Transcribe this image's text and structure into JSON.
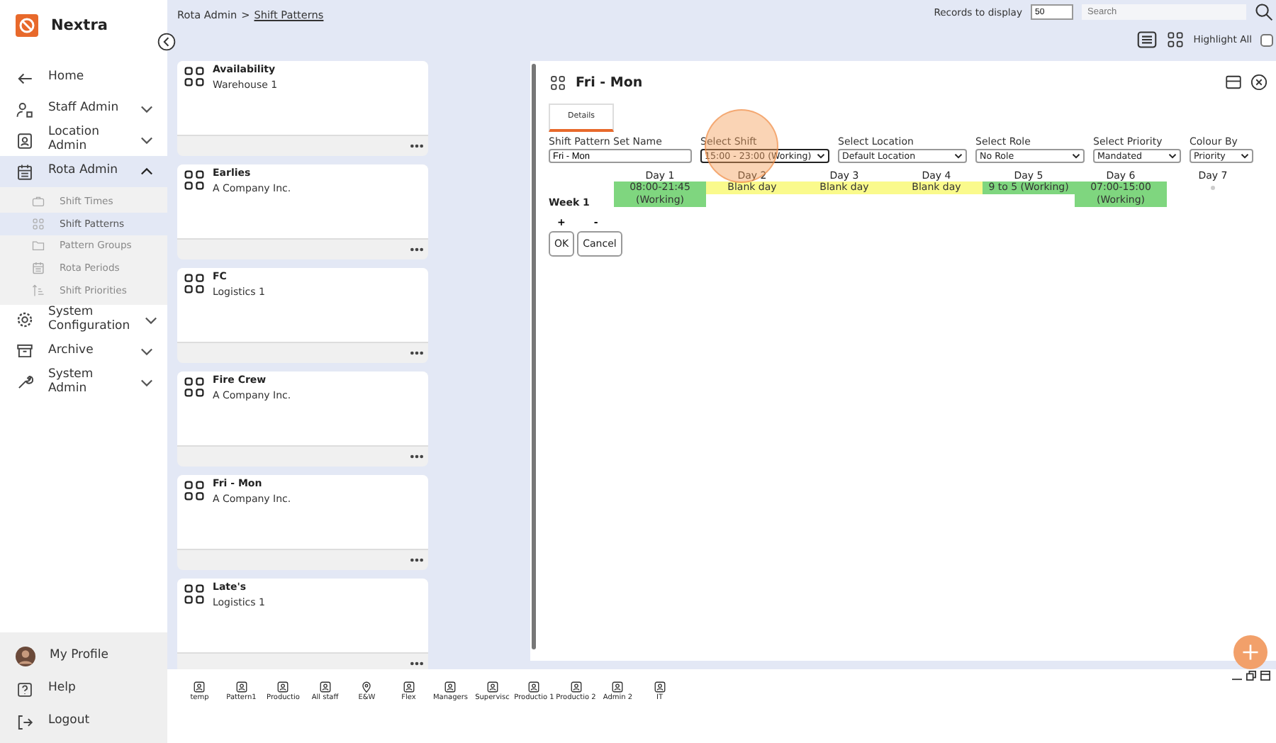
{
  "brand": {
    "name": "Nextra"
  },
  "nav": [
    {
      "label": "Home",
      "selected": false
    },
    {
      "label": "Staff Admin",
      "expanded": false,
      "selected": false
    },
    {
      "label": "Location Admin",
      "expanded": false,
      "selected": false
    },
    {
      "label": "Rota Admin",
      "expanded": true,
      "selected": true,
      "children": [
        {
          "label": "Shift Times",
          "selected": false
        },
        {
          "label": "Shift Patterns",
          "selected": true
        },
        {
          "label": "Pattern Groups",
          "selected": false
        },
        {
          "label": "Rota Periods",
          "selected": false
        },
        {
          "label": "Shift Priorities",
          "selected": false
        }
      ]
    },
    {
      "label": "System Configuration",
      "expanded": false,
      "selected": false
    },
    {
      "label": "Archive",
      "expanded": false,
      "selected": false
    },
    {
      "label": "System Admin",
      "expanded": false,
      "selected": false
    }
  ],
  "footer": [
    {
      "label": "My Profile"
    },
    {
      "label": "Help"
    },
    {
      "label": "Logout"
    }
  ],
  "breadcrumb": {
    "parent": "Rota Admin",
    "separator": ">",
    "current": "Shift Patterns"
  },
  "toolbar": {
    "records_label": "Records to display",
    "records_value": "50",
    "search_placeholder": "Search",
    "highlight_label": "Highlight All",
    "highlight_checked": false
  },
  "cards": [
    {
      "title": "Availability",
      "subtitle": "Warehouse 1"
    },
    {
      "title": "Earlies",
      "subtitle": "A Company Inc."
    },
    {
      "title": "FC",
      "subtitle": "Logistics 1"
    },
    {
      "title": "Fire Crew",
      "subtitle": "A Company Inc."
    },
    {
      "title": "Fri - Mon",
      "subtitle": "A Company Inc."
    },
    {
      "title": "Late's",
      "subtitle": "Logistics 1"
    }
  ],
  "detail": {
    "title": "Fri - Mon",
    "tabs": [
      {
        "label": "Details",
        "selected": true
      }
    ],
    "fields": [
      {
        "label": "Shift Pattern Set Name",
        "kind": "text",
        "value": "Fri - Mon"
      },
      {
        "label": "Select Shift",
        "kind": "select",
        "value": "15:00 - 23:00 (Working)"
      },
      {
        "label": "Select Location",
        "kind": "select",
        "value": "Default Location"
      },
      {
        "label": "Select Role",
        "kind": "select",
        "value": "No Role"
      },
      {
        "label": "Select Priority",
        "kind": "select",
        "value": "Mandated"
      },
      {
        "label": "Colour By",
        "kind": "select",
        "value": "Priority"
      }
    ],
    "week_label": "Week 1",
    "days": [
      {
        "label": "Day 1",
        "kind": "working",
        "text": "08:00-21:45 (Working)"
      },
      {
        "label": "Day 2",
        "kind": "blank",
        "text": "Blank day"
      },
      {
        "label": "Day 3",
        "kind": "blank",
        "text": "Blank day"
      },
      {
        "label": "Day 4",
        "kind": "blank",
        "text": "Blank day"
      },
      {
        "label": "Day 5",
        "kind": "working",
        "text": "9 to 5 (Working)"
      },
      {
        "label": "Day 6",
        "kind": "working",
        "text": "07:00-15:00 (Working)"
      },
      {
        "label": "Day 7",
        "kind": "empty"
      }
    ],
    "add_label": "+",
    "remove_label": "-",
    "buttons": [
      "OK",
      "Cancel"
    ]
  },
  "taskbar": [
    {
      "label": "temp",
      "kind": "person"
    },
    {
      "label": "Pattern1",
      "kind": "person"
    },
    {
      "label": "Productio",
      "kind": "person"
    },
    {
      "label": "All staff",
      "kind": "person"
    },
    {
      "label": "E&W",
      "kind": "location"
    },
    {
      "label": "Flex",
      "kind": "person"
    },
    {
      "label": "Managers",
      "kind": "person"
    },
    {
      "label": "Supervisc",
      "kind": "person"
    },
    {
      "label": "Productio 1",
      "kind": "person"
    },
    {
      "label": "Productio 2",
      "kind": "person"
    },
    {
      "label": "Admin 2",
      "kind": "person"
    },
    {
      "label": "IT",
      "kind": "person"
    }
  ]
}
